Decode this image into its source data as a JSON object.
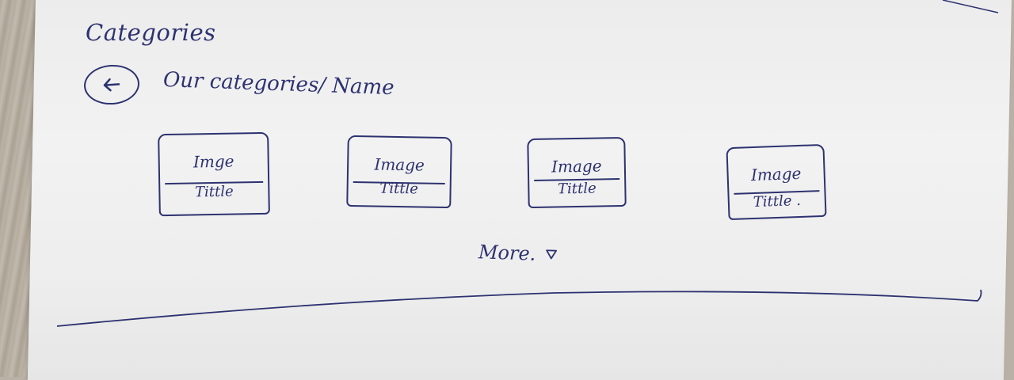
{
  "header": {
    "title": "Categories"
  },
  "nav": {
    "back_icon": "arrow-left-icon",
    "breadcrumb": "Our categories/ Name"
  },
  "categories": [
    {
      "image": "Imge",
      "title": "Tittle"
    },
    {
      "image": "Image",
      "title": "Tittle"
    },
    {
      "image": "Image",
      "title": "Tittle"
    },
    {
      "image": "Image",
      "title": "Tittle ."
    }
  ],
  "more": {
    "label": "More.",
    "icon": "triangle-down-icon"
  },
  "colors": {
    "ink": "#2d3270",
    "paper": "#efefef"
  }
}
